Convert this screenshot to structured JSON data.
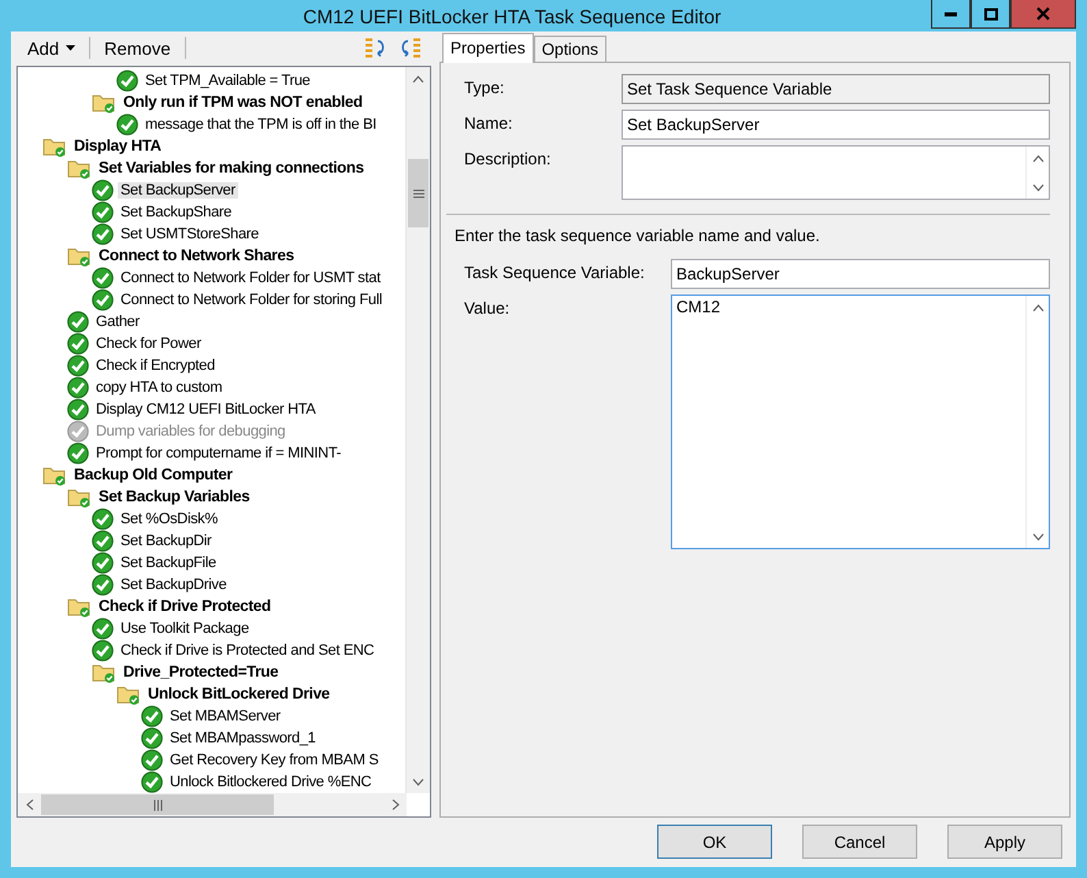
{
  "window": {
    "title": "CM12 UEFI BitLocker HTA Task Sequence Editor"
  },
  "toolbar": {
    "add": "Add",
    "remove": "Remove"
  },
  "tree": {
    "items": [
      {
        "kind": "continuation",
        "children": [
          {
            "kind": "continuation",
            "children": [
              {
                "kind": "continuation",
                "children": [
                  {
                    "kind": "step",
                    "label": "Set TPM_Available = True",
                    "selected": false,
                    "disabled": false
                  }
                ]
              },
              {
                "kind": "group",
                "label": "Only run if TPM was NOT enabled",
                "selected": false,
                "disabled": false,
                "children": [
                  {
                    "kind": "step",
                    "label": "message that the TPM is off in the BI",
                    "selected": false,
                    "disabled": false
                  }
                ]
              }
            ]
          }
        ]
      },
      {
        "kind": "group",
        "label": "Display HTA",
        "selected": false,
        "disabled": false,
        "children": [
          {
            "kind": "group",
            "label": "Set Variables for making connections",
            "selected": false,
            "disabled": false,
            "children": [
              {
                "kind": "step",
                "label": "Set BackupServer",
                "selected": true,
                "disabled": false
              },
              {
                "kind": "step",
                "label": "Set BackupShare",
                "selected": false,
                "disabled": false
              },
              {
                "kind": "step",
                "label": "Set USMTStoreShare",
                "selected": false,
                "disabled": false
              }
            ]
          },
          {
            "kind": "group",
            "label": "Connect to Network Shares",
            "selected": false,
            "disabled": false,
            "children": [
              {
                "kind": "step",
                "label": "Connect to Network Folder for USMT stat",
                "selected": false,
                "disabled": false
              },
              {
                "kind": "step",
                "label": "Connect to Network Folder for storing Full",
                "selected": false,
                "disabled": false
              }
            ]
          },
          {
            "kind": "step",
            "label": "Gather",
            "selected": false,
            "disabled": false
          },
          {
            "kind": "step",
            "label": "Check for Power",
            "selected": false,
            "disabled": false
          },
          {
            "kind": "step",
            "label": "Check if Encrypted",
            "selected": false,
            "disabled": false
          },
          {
            "kind": "step",
            "label": "copy HTA to custom",
            "selected": false,
            "disabled": false
          },
          {
            "kind": "step",
            "label": "Display CM12 UEFI BitLocker HTA",
            "selected": false,
            "disabled": false
          },
          {
            "kind": "step",
            "label": "Dump variables for debugging",
            "selected": false,
            "disabled": true
          },
          {
            "kind": "step",
            "label": "Prompt for computername if = MININT-",
            "selected": false,
            "disabled": false
          }
        ]
      },
      {
        "kind": "group",
        "label": "Backup Old Computer",
        "selected": false,
        "disabled": false,
        "children": [
          {
            "kind": "group",
            "label": "Set Backup Variables",
            "selected": false,
            "disabled": false,
            "children": [
              {
                "kind": "step",
                "label": "Set %OsDisk%",
                "selected": false,
                "disabled": false
              },
              {
                "kind": "step",
                "label": "Set BackupDir",
                "selected": false,
                "disabled": false
              },
              {
                "kind": "step",
                "label": "Set BackupFile",
                "selected": false,
                "disabled": false
              },
              {
                "kind": "step",
                "label": "Set BackupDrive",
                "selected": false,
                "disabled": false
              }
            ]
          },
          {
            "kind": "group",
            "label": "Check if Drive Protected",
            "selected": false,
            "disabled": false,
            "children": [
              {
                "kind": "step",
                "label": "Use Toolkit Package",
                "selected": false,
                "disabled": false
              },
              {
                "kind": "step",
                "label": "Check if Drive is Protected and Set ENC",
                "selected": false,
                "disabled": false
              },
              {
                "kind": "group",
                "label": "Drive_Protected=True",
                "selected": false,
                "disabled": false,
                "children": [
                  {
                    "kind": "group",
                    "label": "Unlock BitLockered Drive",
                    "selected": false,
                    "disabled": false,
                    "children": [
                      {
                        "kind": "step",
                        "label": "Set MBAMServer",
                        "selected": false,
                        "disabled": false
                      },
                      {
                        "kind": "step",
                        "label": "Set MBAMpassword_1",
                        "selected": false,
                        "disabled": false
                      },
                      {
                        "kind": "step",
                        "label": "Get Recovery Key from MBAM S",
                        "selected": false,
                        "disabled": false
                      },
                      {
                        "kind": "step",
                        "label": "Unlock Bitlockered Drive %ENC",
                        "selected": false,
                        "disabled": false
                      }
                    ]
                  }
                ]
              }
            ]
          }
        ]
      }
    ]
  },
  "tabs": [
    {
      "label": "Properties",
      "selected": true
    },
    {
      "label": "Options",
      "selected": false
    }
  ],
  "properties": {
    "type_label": "Type:",
    "type_value": "Set Task Sequence Variable",
    "name_label": "Name:",
    "name_value": "Set BackupServer",
    "description_label": "Description:",
    "instruction": "Enter the task sequence variable name and value.",
    "variable_label": "Task Sequence Variable:",
    "variable_value": "BackupServer",
    "value_label": "Value:",
    "value_value": "CM12"
  },
  "buttons": [
    {
      "label": "OK",
      "kind": "default"
    },
    {
      "label": "Cancel",
      "kind": "normal"
    },
    {
      "label": "Apply",
      "kind": "normal"
    }
  ]
}
